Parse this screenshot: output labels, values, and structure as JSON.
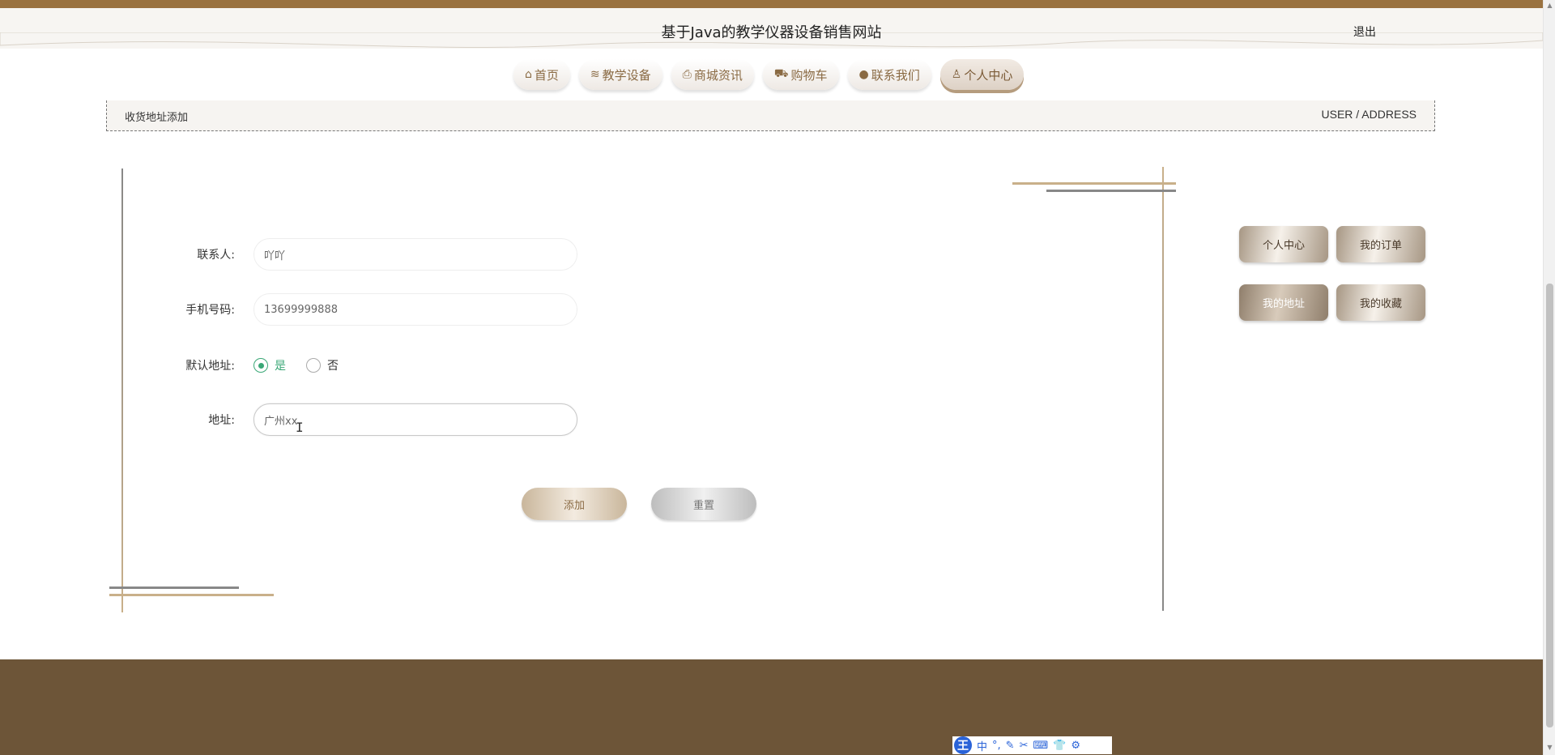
{
  "header": {
    "site_title": "基于Java的教学仪器设备销售网站",
    "logout_label": "退出"
  },
  "nav": {
    "items": [
      {
        "label": "首页",
        "icon": "home-icon"
      },
      {
        "label": "教学设备",
        "icon": "layers-icon"
      },
      {
        "label": "商城资讯",
        "icon": "printer-icon"
      },
      {
        "label": "购物车",
        "icon": "cart-icon"
      },
      {
        "label": "联系我们",
        "icon": "chat-icon"
      },
      {
        "label": "个人中心",
        "icon": "user-icon"
      }
    ],
    "active": "个人中心"
  },
  "breadcrumb": {
    "title": "收货地址添加",
    "en": "USER / ADDRESS"
  },
  "form": {
    "contact_label": "联系人:",
    "contact_value": "吖吖",
    "phone_label": "手机号码:",
    "phone_value": "13699999888",
    "default_label": "默认地址:",
    "default_yes": "是",
    "default_no": "否",
    "default_selected": "是",
    "address_label": "地址:",
    "address_value": "广州xx",
    "add_button": "添加",
    "reset_button": "重置"
  },
  "sidebar": {
    "items": [
      {
        "label": "个人中心"
      },
      {
        "label": "我的订单"
      },
      {
        "label": "我的地址"
      },
      {
        "label": "我的收藏"
      }
    ],
    "active": "我的地址"
  },
  "ime": {
    "logo": "王",
    "mode": "中"
  },
  "colors": {
    "topbar": "#9a7240",
    "footer": "#6d5538",
    "accent_gold": "#c9b08a",
    "radio_green": "#3aa776"
  }
}
